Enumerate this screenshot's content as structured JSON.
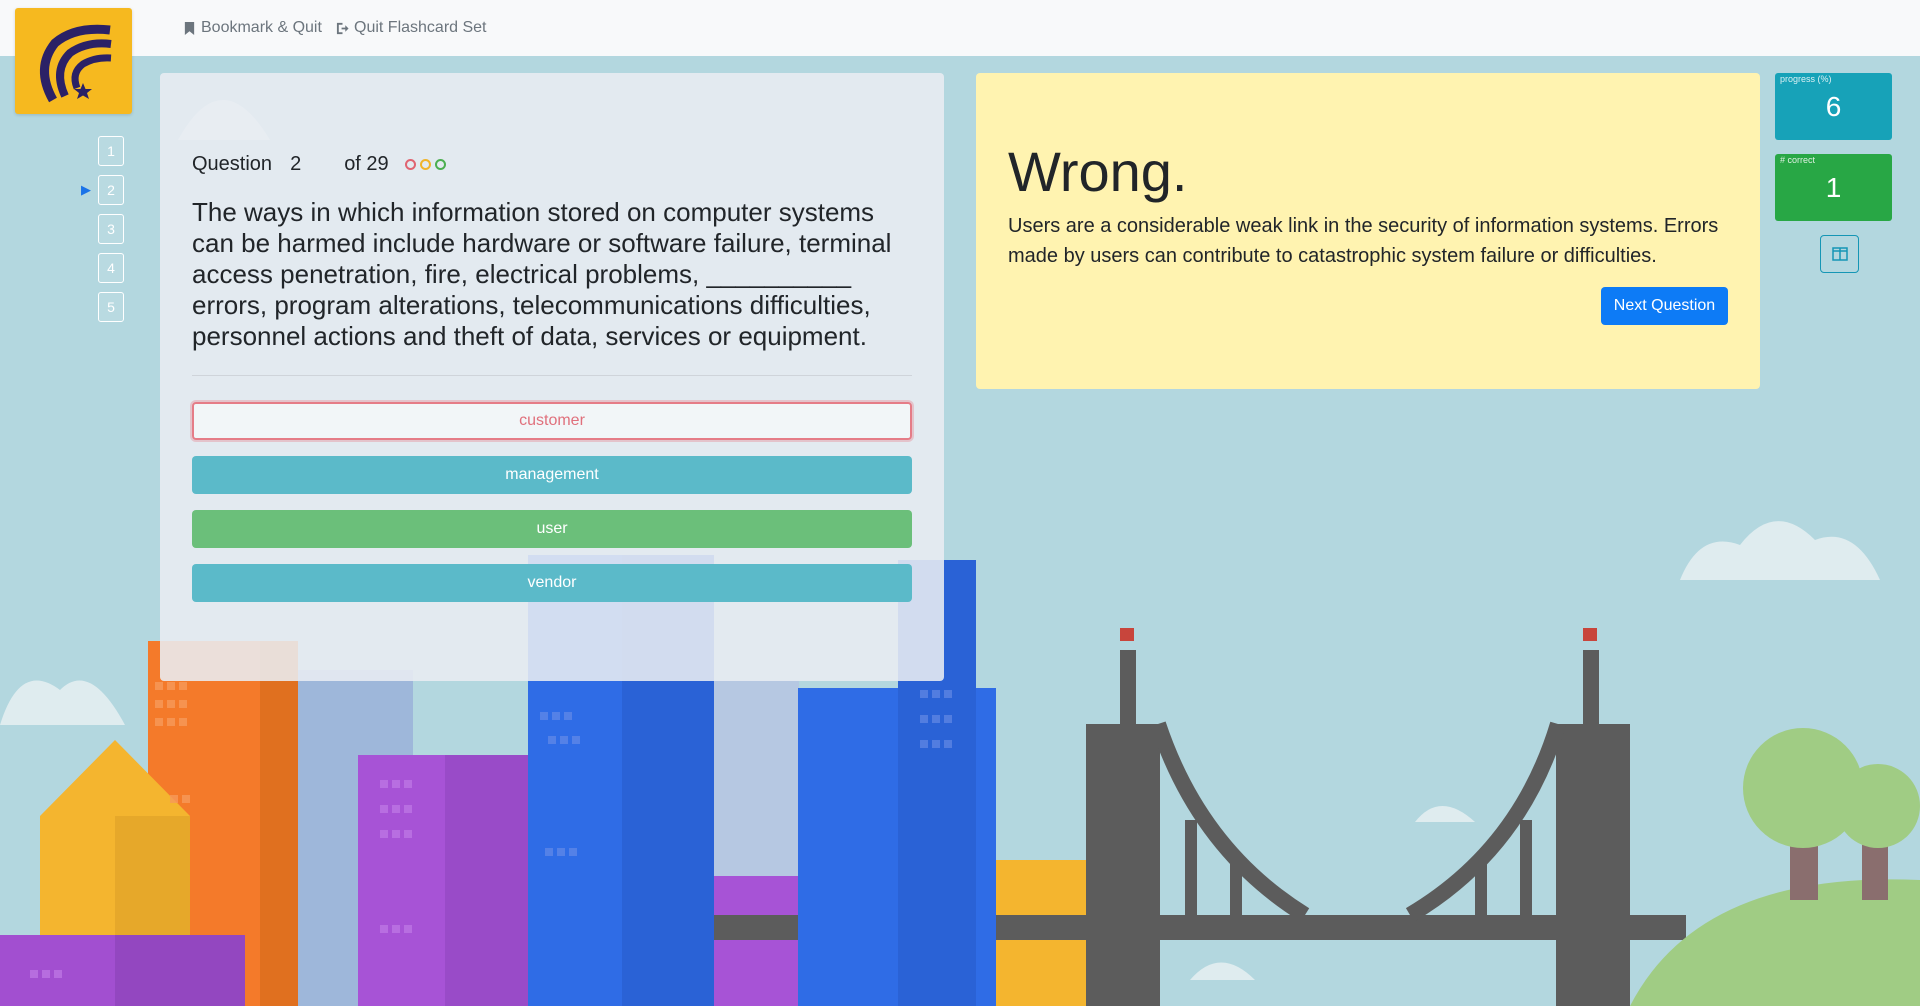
{
  "topbar": {
    "bookmark_label": "Bookmark & Quit",
    "quit_label": "Quit Flashcard Set"
  },
  "nav": {
    "items": [
      "1",
      "2",
      "3",
      "4",
      "5"
    ],
    "current": "2"
  },
  "question": {
    "label": "Question",
    "number": "2",
    "of_text": "of 29",
    "status_colors": [
      "#e06471",
      "#f0b429",
      "#4caf50"
    ],
    "text": "The ways in which information stored on computer systems can be harmed include hardware or software failure, terminal access penetration, fire, electrical problems, __________ errors, program alterations, telecommunications difficulties, personnel actions and theft of data, services or equipment."
  },
  "answers": [
    {
      "label": "customer",
      "state": "selected-wrong",
      "color": "#e0707c"
    },
    {
      "label": "management",
      "state": "neutral",
      "color": "#5bbac9"
    },
    {
      "label": "user",
      "state": "correct",
      "color": "#6bbf7a"
    },
    {
      "label": "vendor",
      "state": "neutral",
      "color": "#5bbac9"
    }
  ],
  "feedback": {
    "title": "Wrong.",
    "text": "Users are a considerable weak link in the security of information systems. Errors made by users can contribute to catastrophic system failure or difficulties.",
    "next_label": "Next Question"
  },
  "stats": {
    "progress_label": "progress (%)",
    "progress_value": "6",
    "progress_color": "#17a2b8",
    "correct_label": "# correct",
    "correct_value": "1",
    "correct_color": "#28a745"
  },
  "icons": {
    "bookmark": "bookmark-icon",
    "quit": "sign-out-icon",
    "layout": "columns-icon",
    "logo": "logo-icon"
  }
}
